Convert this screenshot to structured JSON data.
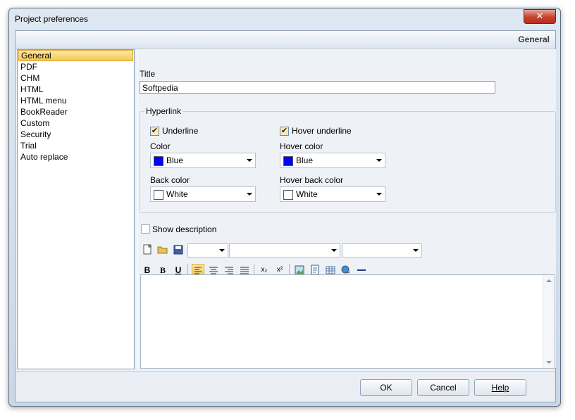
{
  "window": {
    "title": "Project preferences",
    "close_glyph": "✕"
  },
  "header": {
    "section": "General"
  },
  "nav": {
    "items": [
      {
        "label": "General",
        "selected": true
      },
      {
        "label": "PDF"
      },
      {
        "label": "CHM"
      },
      {
        "label": "HTML"
      },
      {
        "label": "HTML menu"
      },
      {
        "label": "BookReader"
      },
      {
        "label": "Custom"
      },
      {
        "label": "Security"
      },
      {
        "label": "Trial"
      },
      {
        "label": "Auto replace"
      }
    ]
  },
  "general": {
    "title_label": "Title",
    "title_value": "Softpedia",
    "hyperlink": {
      "group_label": "Hyperlink",
      "underline_label": "Underline",
      "underline_checked": true,
      "hover_underline_label": "Hover underline",
      "hover_underline_checked": true,
      "color_label": "Color",
      "color_value": "Blue",
      "color_hex": "#0000ff",
      "hover_color_label": "Hover color",
      "hover_color_value": "Blue",
      "hover_color_hex": "#0000ff",
      "back_color_label": "Back color",
      "back_color_value": "White",
      "back_color_hex": "#ffffff",
      "hover_back_color_label": "Hover back color",
      "hover_back_color_value": "White",
      "hover_back_color_hex": "#ffffff"
    },
    "show_description_label": "Show description",
    "show_description_checked": false,
    "toolbar": {
      "bold_glyph": "B",
      "bold2_glyph": "B",
      "underline_glyph": "U",
      "subscript_glyph": "x₂",
      "superscript_glyph": "x²",
      "font_value": "",
      "size_value": "",
      "style_value": ""
    }
  },
  "footer": {
    "ok_label": "OK",
    "cancel_label": "Cancel",
    "help_label": "Help"
  },
  "colors": {
    "accent": "#f6c850",
    "border": "#7f9db9",
    "client_bg": "#eef1f6"
  }
}
